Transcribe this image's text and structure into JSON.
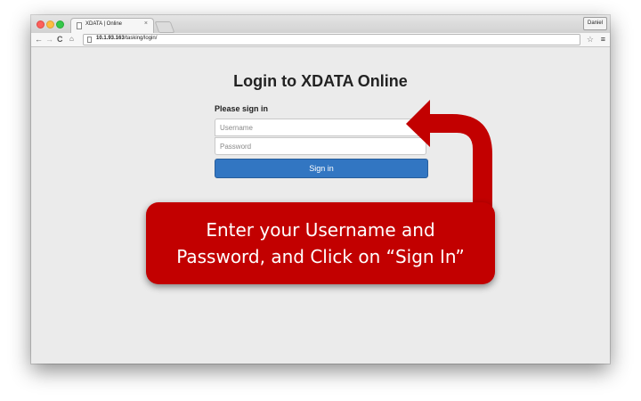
{
  "browser": {
    "tab_title": "XDATA | Online",
    "tab_close": "×",
    "profile_name": "Daniel",
    "url_host": "10.1.93.163",
    "url_path": "/tasking/login/",
    "back_glyph": "←",
    "forward_glyph": "→",
    "reload_glyph": "C",
    "home_glyph": "⌂",
    "star_glyph": "☆",
    "menu_glyph": "≡"
  },
  "page": {
    "heading": "Login to XDATA Online",
    "signin_label": "Please sign in",
    "username_placeholder": "Username",
    "password_placeholder": "Password",
    "username_value": "",
    "password_value": "",
    "signin_button": "Sign in"
  },
  "annotation": {
    "line1": "Enter your Username and",
    "line2": "Password, and Click on “Sign In”",
    "color": "#c20000"
  },
  "icons": [
    "back-arrow-icon",
    "forward-arrow-icon",
    "reload-icon",
    "home-icon",
    "page-icon",
    "star-icon",
    "menu-icon",
    "close-icon"
  ],
  "colors": {
    "accent": "#3276c2",
    "callout": "#c20000",
    "page_bg": "#ebebeb"
  }
}
